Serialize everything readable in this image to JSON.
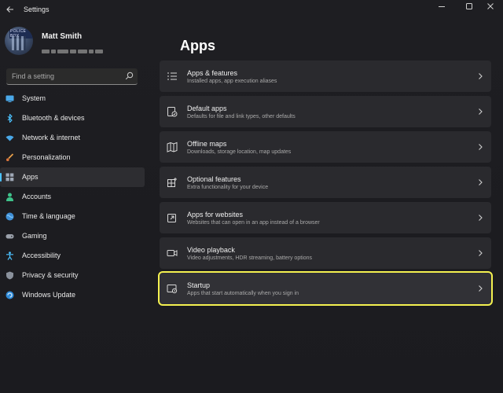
{
  "window": {
    "title": "Settings"
  },
  "profile": {
    "name": "Matt Smith",
    "avatar_tag": "POLICE BOX"
  },
  "search": {
    "placeholder": "Find a setting"
  },
  "sidebar": {
    "items": [
      {
        "label": "System",
        "icon": "monitor-icon"
      },
      {
        "label": "Bluetooth & devices",
        "icon": "bluetooth-icon"
      },
      {
        "label": "Network & internet",
        "icon": "wifi-icon"
      },
      {
        "label": "Personalization",
        "icon": "brush-icon"
      },
      {
        "label": "Apps",
        "icon": "apps-icon",
        "active": true
      },
      {
        "label": "Accounts",
        "icon": "person-icon"
      },
      {
        "label": "Time & language",
        "icon": "globe-icon"
      },
      {
        "label": "Gaming",
        "icon": "gamepad-icon"
      },
      {
        "label": "Accessibility",
        "icon": "accessibility-icon"
      },
      {
        "label": "Privacy & security",
        "icon": "shield-icon"
      },
      {
        "label": "Windows Update",
        "icon": "update-icon"
      }
    ]
  },
  "main": {
    "title": "Apps",
    "cards": [
      {
        "title": "Apps & features",
        "subtitle": "Installed apps, app execution aliases",
        "icon": "list-icon"
      },
      {
        "title": "Default apps",
        "subtitle": "Defaults for file and link types, other defaults",
        "icon": "default-apps-icon"
      },
      {
        "title": "Offline maps",
        "subtitle": "Downloads, storage location, map updates",
        "icon": "map-icon"
      },
      {
        "title": "Optional features",
        "subtitle": "Extra functionality for your device",
        "icon": "add-grid-icon"
      },
      {
        "title": "Apps for websites",
        "subtitle": "Websites that can open in an app instead of a browser",
        "icon": "open-link-icon"
      },
      {
        "title": "Video playback",
        "subtitle": "Video adjustments, HDR streaming, battery options",
        "icon": "video-icon"
      },
      {
        "title": "Startup",
        "subtitle": "Apps that start automatically when you sign in",
        "icon": "startup-icon",
        "highlighted": true
      }
    ]
  },
  "colors": {
    "accent": "#4cc2ff",
    "highlight": "#f4f150",
    "card_bg": "#2a2a2e",
    "background": "#1c1c1c"
  }
}
